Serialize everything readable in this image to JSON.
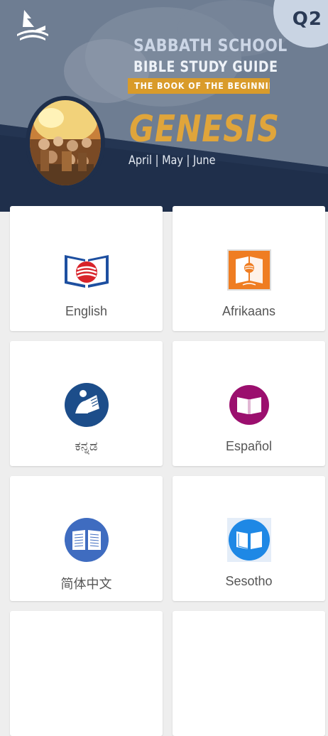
{
  "banner": {
    "quarter_badge": "Q2",
    "title_line1": "SABBATH SCHOOL",
    "title_line2": "BIBLE STUDY GUIDE",
    "subtitle": "THE BOOK OF THE BEGINNING",
    "book": "GENESIS",
    "dates": "April | May | June"
  },
  "languages": [
    {
      "label": "English",
      "icon": "open-book-globe-icon"
    },
    {
      "label": "Afrikaans",
      "icon": "orange-book-icon"
    },
    {
      "label": "ಕನ್ನಡ",
      "icon": "reader-book-icon"
    },
    {
      "label": "Español",
      "icon": "magenta-book-icon"
    },
    {
      "label": "简体中文",
      "icon": "blue-book-icon"
    },
    {
      "label": "Sesotho",
      "icon": "lightblue-book-icon"
    }
  ],
  "colors": {
    "accent_gold": "#e0a53b",
    "banner_dark": "#1f2f4b",
    "banner_slate": "#6c7b8f"
  }
}
